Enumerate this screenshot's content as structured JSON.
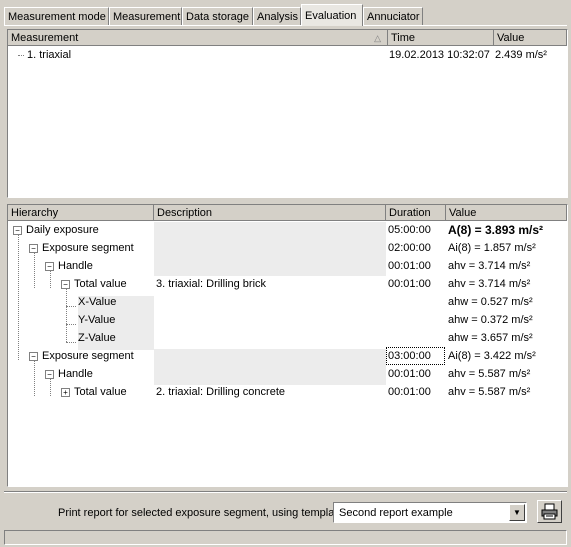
{
  "tabs": [
    "Measurement mode",
    "Measurement",
    "Data storage",
    "Analysis",
    "Evaluation",
    "Annuciator"
  ],
  "measurement_table": {
    "columns": [
      "Measurement",
      "Time",
      "Value"
    ],
    "rows": [
      {
        "name": "1. triaxial",
        "time": "19.02.2013 10:32:07",
        "value": "2.439 m/s²"
      }
    ]
  },
  "hierarchy_table": {
    "columns": [
      "Hierarchy",
      "Description",
      "Duration",
      "Value"
    ],
    "rows": [
      {
        "label": "Daily exposure",
        "description": "",
        "duration": "05:00:00",
        "value": "A(8) = 3.893 m/s²"
      },
      {
        "label": "Exposure segment",
        "description": "",
        "duration": "02:00:00",
        "value": "Ai(8) = 1.857 m/s²"
      },
      {
        "label": "Handle",
        "description": "",
        "duration": "00:01:00",
        "value": "ahv = 3.714 m/s²"
      },
      {
        "label": "Total value",
        "description": "3. triaxial: Drilling brick",
        "duration": "00:01:00",
        "value": "ahv = 3.714 m/s²"
      },
      {
        "label": "X-Value",
        "description": "",
        "duration": "",
        "value": "ahw = 0.527 m/s²"
      },
      {
        "label": "Y-Value",
        "description": "",
        "duration": "",
        "value": "ahw = 0.372 m/s²"
      },
      {
        "label": "Z-Value",
        "description": "",
        "duration": "",
        "value": "ahw = 3.657 m/s²"
      },
      {
        "label": "Exposure segment",
        "description": "",
        "duration": "03:00:00",
        "value": "Ai(8) = 3.422 m/s²"
      },
      {
        "label": "Handle",
        "description": "",
        "duration": "00:01:00",
        "value": "ahv = 5.587 m/s²"
      },
      {
        "label": "Total value",
        "description": "2. triaxial: Drilling concrete",
        "duration": "00:01:00",
        "value": "ahv = 5.587 m/s²"
      }
    ]
  },
  "footer": {
    "print_label": "Print report for selected exposure segment, using template:",
    "template_value": "Second report example"
  },
  "icons": {
    "sort": "sort-ascending-icon",
    "dropdown": "chevron-down-icon",
    "print": "printer-icon"
  }
}
